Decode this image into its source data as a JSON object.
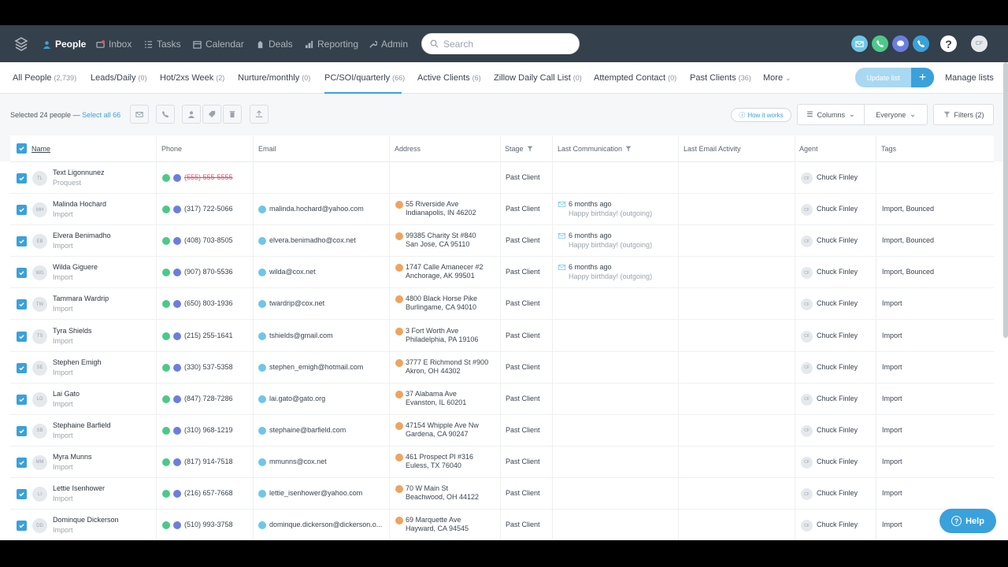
{
  "nav": {
    "items": [
      {
        "label": "People",
        "icon": "person-icon",
        "active": true
      },
      {
        "label": "Inbox",
        "icon": "inbox-icon",
        "active": false
      },
      {
        "label": "Tasks",
        "icon": "list-icon",
        "active": false
      },
      {
        "label": "Calendar",
        "icon": "calendar-icon",
        "active": false
      },
      {
        "label": "Deals",
        "icon": "deals-icon",
        "active": false
      },
      {
        "label": "Reporting",
        "icon": "chart-icon",
        "active": false
      },
      {
        "label": "Admin",
        "icon": "wrench-icon",
        "active": false
      }
    ],
    "search_placeholder": "Search",
    "user_initials": "CF",
    "help_glyph": "?"
  },
  "tabs": [
    {
      "label": "All People",
      "count": "(2,739)"
    },
    {
      "label": "Leads/Daily",
      "count": "(0)"
    },
    {
      "label": "Hot/2xs Week",
      "count": "(2)"
    },
    {
      "label": "Nurture/monthly",
      "count": "(0)"
    },
    {
      "label": "PC/SOI/quarterly",
      "count": "(66)"
    },
    {
      "label": "Active Clients",
      "count": "(6)"
    },
    {
      "label": "Zillow Daily Call List",
      "count": "(0)"
    },
    {
      "label": "Attempted Contact",
      "count": "(0)"
    },
    {
      "label": "Past Clients",
      "count": "(36)"
    },
    {
      "label": "More",
      "count": ""
    }
  ],
  "tabs_actions": {
    "update_list": "Update list",
    "plus": "+",
    "manage_lists": "Manage lists"
  },
  "toolbar": {
    "selected_text": "Selected 24 people — ",
    "select_all": "Select all 66",
    "how_it_works": "How it works",
    "columns": "Columns",
    "everyone": "Everyone",
    "filters": "Filters (2)"
  },
  "columns": {
    "name": "Name",
    "phone": "Phone",
    "email": "Email",
    "address": "Address",
    "stage": "Stage",
    "last_comm": "Last Communication",
    "last_email": "Last Email Activity",
    "agent": "Agent",
    "tags": "Tags"
  },
  "rows": [
    {
      "initials": "TL",
      "name": "Text Ligonnunez",
      "source": "Proquest",
      "phone": "(555) 555-5555",
      "phone_invalid": true,
      "email": "",
      "addr1": "",
      "addr2": "",
      "stage": "Past Client",
      "comm1": "",
      "comm2": "",
      "agent": "Chuck Finley",
      "tags": ""
    },
    {
      "initials": "MH",
      "name": "Malinda Hochard",
      "source": "Import",
      "phone": "(317) 722-5066",
      "email": "malinda.hochard@yahoo.com",
      "addr1": "55 Riverside Ave",
      "addr2": "Indianapolis, IN 46202",
      "stage": "Past Client",
      "comm1": "6 months ago",
      "comm2": "Happy birthday! (outgoing)",
      "agent": "Chuck Finley",
      "tags": "Import, Bounced"
    },
    {
      "initials": "EB",
      "name": "Elvera Benimadho",
      "source": "Import",
      "phone": "(408) 703-8505",
      "email": "elvera.benimadho@cox.net",
      "addr1": "99385 Charity St #840",
      "addr2": "San Jose, CA 95110",
      "stage": "Past Client",
      "comm1": "6 months ago",
      "comm2": "Happy birthday! (outgoing)",
      "agent": "Chuck Finley",
      "tags": "Import, Bounced"
    },
    {
      "initials": "WG",
      "name": "Wilda Giguere",
      "source": "Import",
      "phone": "(907) 870-5536",
      "email": "wilda@cox.net",
      "addr1": "1747 Calle Amanecer #2",
      "addr2": "Anchorage, AK 99501",
      "stage": "Past Client",
      "comm1": "6 months ago",
      "comm2": "Happy birthday! (outgoing)",
      "agent": "Chuck Finley",
      "tags": "Import, Bounced"
    },
    {
      "initials": "TW",
      "name": "Tammara Wardrip",
      "source": "Import",
      "phone": "(650) 803-1936",
      "email": "twardrip@cox.net",
      "addr1": "4800 Black Horse Pike",
      "addr2": "Burlingame, CA 94010",
      "stage": "Past Client",
      "comm1": "",
      "comm2": "",
      "agent": "Chuck Finley",
      "tags": "Import"
    },
    {
      "initials": "TS",
      "name": "Tyra Shields",
      "source": "Import",
      "phone": "(215) 255-1641",
      "email": "tshields@gmail.com",
      "addr1": "3 Fort Worth Ave",
      "addr2": "Philadelphia, PA 19106",
      "stage": "Past Client",
      "comm1": "",
      "comm2": "",
      "agent": "Chuck Finley",
      "tags": "Import"
    },
    {
      "initials": "SE",
      "name": "Stephen Emigh",
      "source": "Import",
      "phone": "(330) 537-5358",
      "email": "stephen_emigh@hotmail.com",
      "addr1": "3777 E Richmond St #900",
      "addr2": "Akron, OH 44302",
      "stage": "Past Client",
      "comm1": "",
      "comm2": "",
      "agent": "Chuck Finley",
      "tags": "Import"
    },
    {
      "initials": "LG",
      "name": "Lai Gato",
      "source": "Import",
      "phone": "(847) 728-7286",
      "email": "lai.gato@gato.org",
      "addr1": "37 Alabama Ave",
      "addr2": "Evanston, IL 60201",
      "stage": "Past Client",
      "comm1": "",
      "comm2": "",
      "agent": "Chuck Finley",
      "tags": "Import"
    },
    {
      "initials": "SB",
      "name": "Stephaine Barfield",
      "source": "Import",
      "phone": "(310) 968-1219",
      "email": "stephaine@barfield.com",
      "addr1": "47154 Whipple Ave Nw",
      "addr2": "Gardena, CA 90247",
      "stage": "Past Client",
      "comm1": "",
      "comm2": "",
      "agent": "Chuck Finley",
      "tags": "Import"
    },
    {
      "initials": "MM",
      "name": "Myra Munns",
      "source": "Import",
      "phone": "(817) 914-7518",
      "email": "mmunns@cox.net",
      "addr1": "461 Prospect Pl #316",
      "addr2": "Euless, TX 76040",
      "stage": "Past Client",
      "comm1": "",
      "comm2": "",
      "agent": "Chuck Finley",
      "tags": "Import"
    },
    {
      "initials": "LI",
      "name": "Lettie Isenhower",
      "source": "Import",
      "phone": "(216) 657-7668",
      "email": "lettie_isenhower@yahoo.com",
      "addr1": "70 W Main St",
      "addr2": "Beachwood, OH 44122",
      "stage": "Past Client",
      "comm1": "",
      "comm2": "",
      "agent": "Chuck Finley",
      "tags": "Import"
    },
    {
      "initials": "DD",
      "name": "Dominque Dickerson",
      "source": "Import",
      "phone": "(510) 993-3758",
      "email": "dominque.dickerson@dickerson.o...",
      "addr1": "69 Marquette Ave",
      "addr2": "Hayward, CA 94545",
      "stage": "Past Client",
      "comm1": "",
      "comm2": "",
      "agent": "Chuck Finley",
      "tags": "Import"
    }
  ],
  "help_label": "Help",
  "colors": {
    "nav_bg": "#34404b",
    "accent": "#3aa1dc",
    "invalid": "#e2526b"
  }
}
